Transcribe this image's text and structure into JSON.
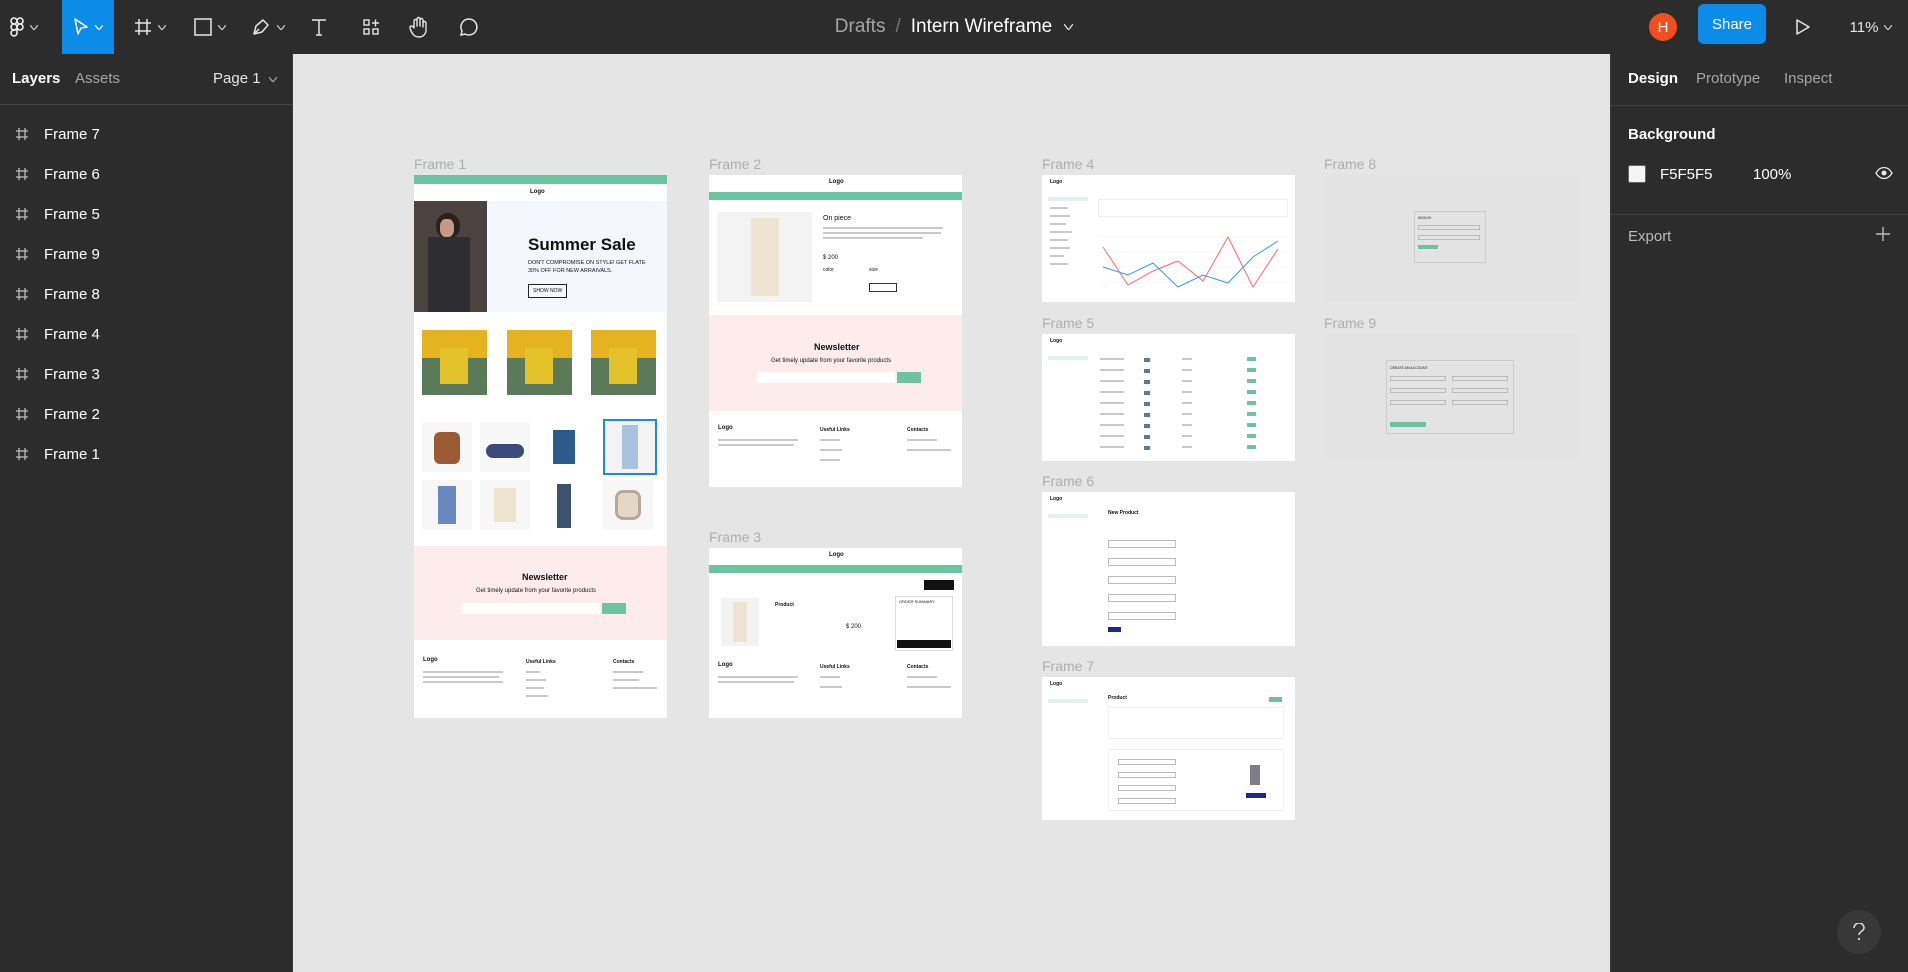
{
  "app": "Figma",
  "toolbar": {
    "breadcrumb_root": "Drafts",
    "breadcrumb_sep": "/",
    "file_name": "Intern Wireframe",
    "avatar_initial": "H",
    "share_label": "Share",
    "zoom": "11%"
  },
  "left_panel": {
    "tab_layers": "Layers",
    "tab_assets": "Assets",
    "page": "Page 1",
    "layers": [
      {
        "label": "Frame 7"
      },
      {
        "label": "Frame 6"
      },
      {
        "label": "Frame 5"
      },
      {
        "label": "Frame 9"
      },
      {
        "label": "Frame 8"
      },
      {
        "label": "Frame 4"
      },
      {
        "label": "Frame 3"
      },
      {
        "label": "Frame 2"
      },
      {
        "label": "Frame 1"
      }
    ]
  },
  "right_panel": {
    "tab_design": "Design",
    "tab_prototype": "Prototype",
    "tab_inspect": "Inspect",
    "background_label": "Background",
    "bg_color": "F5F5F5",
    "bg_opacity": "100%",
    "export_label": "Export"
  },
  "canvas": {
    "frame_labels": {
      "f1": "Frame 1",
      "f2": "Frame 2",
      "f3": "Frame 3",
      "f4": "Frame 4",
      "f5": "Frame 5",
      "f6": "Frame 6",
      "f7": "Frame 7",
      "f8": "Frame 8",
      "f9": "Frame 9"
    },
    "f1": {
      "logo": "Logo",
      "hero_title": "Summer Sale",
      "hero_sub": "DON'T COMPROMISE ON STYLE! GET FLATE 30% OFF FOR NEW ARRAIVALS.",
      "hero_btn": "SHOW NOW",
      "newsletter": "Newsletter",
      "newsletter_sub": "Get timely update from your favorite products",
      "footer_logo": "Logo",
      "useful": "Useful Links",
      "contacts": "Contacts"
    },
    "f2": {
      "logo": "Logo",
      "product": "On piece",
      "price": "$ 200",
      "color": "color",
      "size": "size",
      "newsletter": "Newsletter",
      "newsletter_sub": "Get timely update from your favorite products",
      "footer_logo": "Logo",
      "useful": "Useful Links",
      "contacts": "Contacts"
    },
    "f3": {
      "logo": "Logo",
      "product": "Product",
      "price": "$ 200",
      "summary": "ORDER SUMMARY",
      "footer_logo": "Logo",
      "useful": "Useful Links",
      "contacts": "Contacts"
    },
    "f4": {
      "logo": "Logo"
    },
    "f5": {
      "logo": "Logo"
    },
    "f6": {
      "logo": "Logo",
      "title": "New Product"
    },
    "f7": {
      "logo": "Logo",
      "title": "Product"
    },
    "f8": {
      "title": "SIGN IN"
    },
    "f9": {
      "title": "CREATE AN ACCOUNT"
    }
  },
  "colors": {
    "toolbar": "#2c2c2c",
    "accent": "#0c8ce9",
    "avatar": "#f24e1e",
    "mint": "#6cc3a0",
    "newsletter_bg": "#fdeceb",
    "canvas": "#e5e5e5"
  }
}
